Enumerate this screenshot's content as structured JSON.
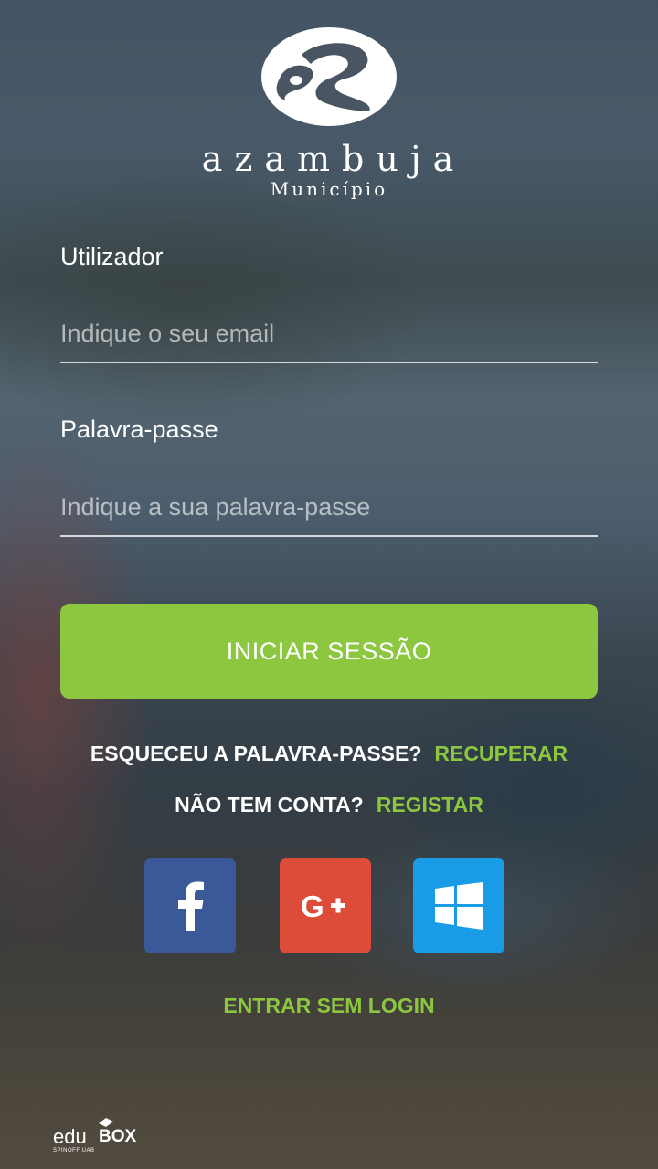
{
  "logo": {
    "name": "azambuja",
    "subtitle": "Município"
  },
  "form": {
    "username_label": "Utilizador",
    "username_placeholder": "Indique o seu email",
    "username_value": "",
    "password_label": "Palavra-passe",
    "password_placeholder": "Indique a sua palavra-passe",
    "password_value": "",
    "login_button": "INICIAR SESSÃO"
  },
  "links": {
    "forgot_question": "ESQUECEU A PALAVRA-PASSE?",
    "forgot_action": "RECUPERAR",
    "no_account_question": "NÃO TEM CONTA?",
    "register_action": "REGISTAR",
    "guest_login": "ENTRAR SEM LOGIN"
  },
  "social": [
    {
      "name": "facebook",
      "icon": "facebook-icon",
      "color": "#3b5998"
    },
    {
      "name": "google-plus",
      "icon": "google-plus-icon",
      "color": "#dd4b39"
    },
    {
      "name": "windows",
      "icon": "windows-icon",
      "color": "#1a9be6"
    }
  ],
  "footer": {
    "brand_left": "edu",
    "brand_right": "BOX",
    "brand_sub": "SPINOFF UAB"
  },
  "colors": {
    "accent": "#8dc63f",
    "text": "#ffffff"
  }
}
